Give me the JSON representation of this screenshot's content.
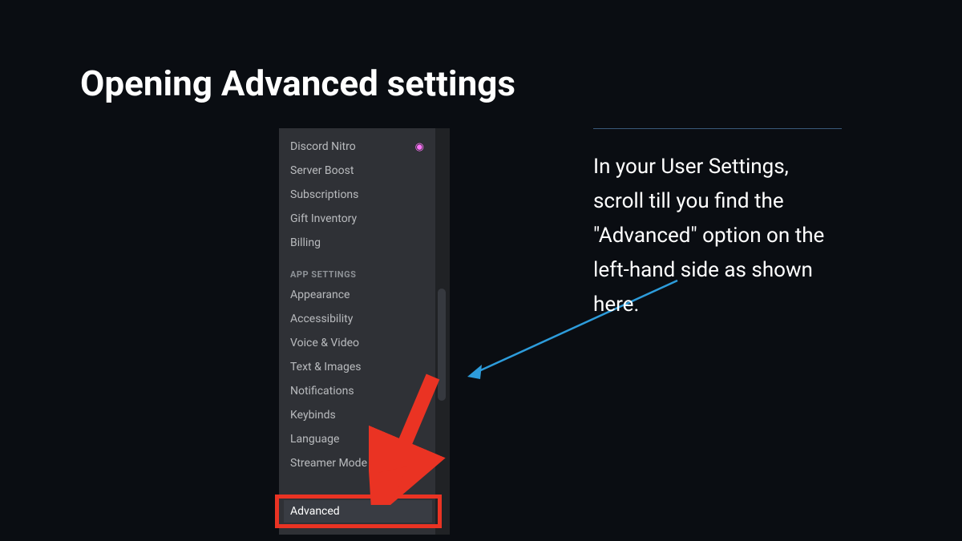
{
  "slide": {
    "title": "Opening Advanced settings"
  },
  "discord_sidebar": {
    "billing_items": [
      "Discord Nitro",
      "Server Boost",
      "Subscriptions",
      "Gift Inventory",
      "Billing"
    ],
    "category_label": "APP SETTINGS",
    "app_settings_items": [
      "Appearance",
      "Accessibility",
      "Voice & Video",
      "Text & Images",
      "Notifications",
      "Keybinds",
      "Language",
      "Streamer Mode"
    ],
    "highlighted_item": "Advanced"
  },
  "instruction": {
    "text": "In your User Settings, scroll till you find the \"Advanced\" option on the left-hand side as shown here."
  }
}
